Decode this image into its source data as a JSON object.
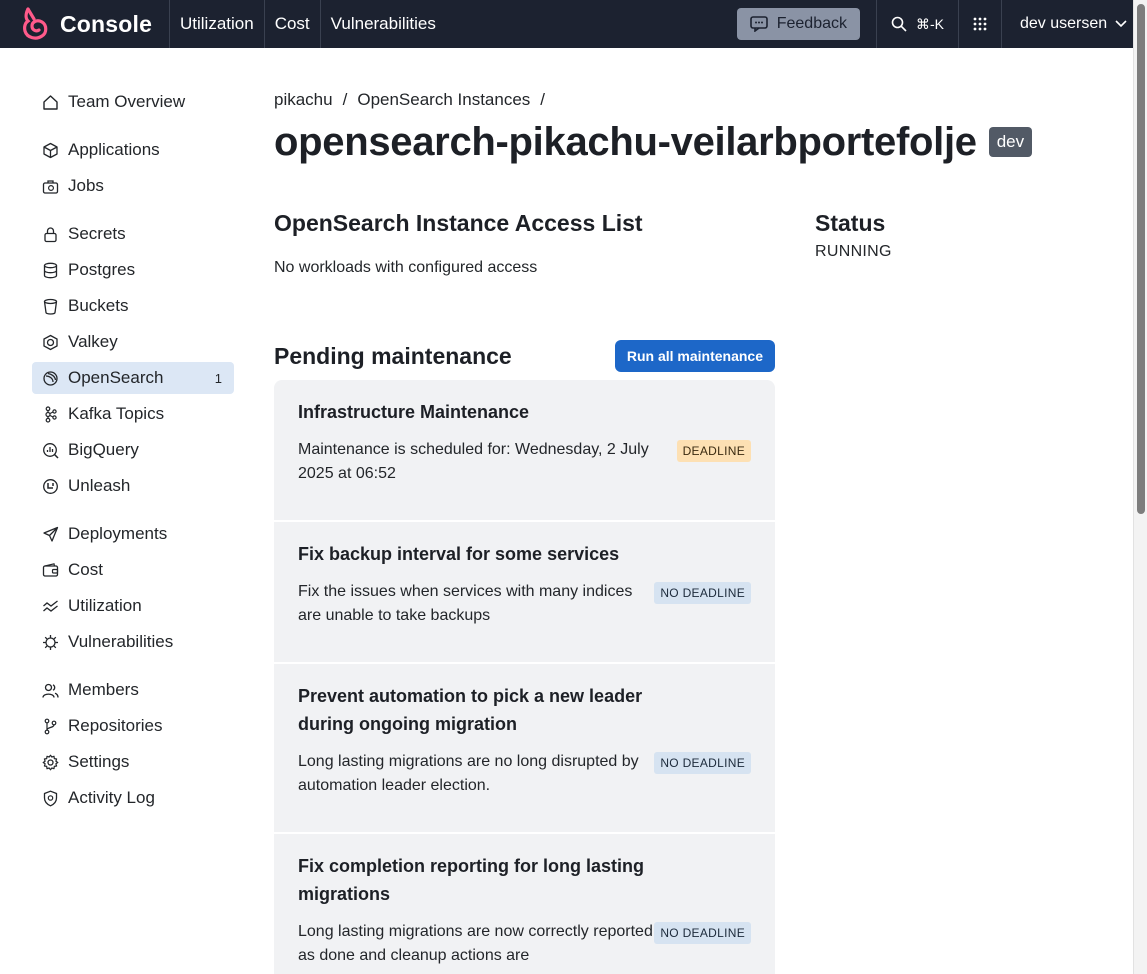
{
  "header": {
    "brand": "Console",
    "nav": [
      "Utilization",
      "Cost",
      "Vulnerabilities"
    ],
    "feedback": "Feedback",
    "search_shortcut": "⌘-K",
    "user": "dev usersen"
  },
  "sidebar": {
    "groups": [
      [
        {
          "label": "Team Overview",
          "icon": "home-icon"
        }
      ],
      [
        {
          "label": "Applications",
          "icon": "cube-icon"
        },
        {
          "label": "Jobs",
          "icon": "briefcase-icon"
        }
      ],
      [
        {
          "label": "Secrets",
          "icon": "lock-icon"
        },
        {
          "label": "Postgres",
          "icon": "database-icon"
        },
        {
          "label": "Buckets",
          "icon": "bucket-icon"
        },
        {
          "label": "Valkey",
          "icon": "valkey-icon"
        },
        {
          "label": "OpenSearch",
          "icon": "opensearch-icon",
          "count": "1",
          "active": true
        },
        {
          "label": "Kafka Topics",
          "icon": "kafka-icon"
        },
        {
          "label": "BigQuery",
          "icon": "bigquery-icon"
        },
        {
          "label": "Unleash",
          "icon": "unleash-icon"
        }
      ],
      [
        {
          "label": "Deployments",
          "icon": "rocket-icon"
        },
        {
          "label": "Cost",
          "icon": "wallet-icon"
        },
        {
          "label": "Utilization",
          "icon": "trend-icon"
        },
        {
          "label": "Vulnerabilities",
          "icon": "virus-icon"
        }
      ],
      [
        {
          "label": "Members",
          "icon": "people-icon"
        },
        {
          "label": "Repositories",
          "icon": "branch-icon"
        },
        {
          "label": "Settings",
          "icon": "gear-icon"
        },
        {
          "label": "Activity Log",
          "icon": "shield-icon"
        }
      ]
    ]
  },
  "breadcrumb": {
    "team": "pikachu",
    "section": "OpenSearch Instances",
    "sep": "/"
  },
  "page": {
    "title": "opensearch-pikachu-veilarbportefolje",
    "env": "dev"
  },
  "access": {
    "heading": "OpenSearch Instance Access List",
    "empty": "No workloads with configured access"
  },
  "status": {
    "heading": "Status",
    "value": "RUNNING"
  },
  "maintenance": {
    "heading": "Pending maintenance",
    "run_all": "Run all maintenance",
    "items": [
      {
        "title": "Infrastructure Maintenance",
        "desc": "Maintenance is scheduled for: Wednesday, 2 July 2025 at 06:52",
        "badge": "DEADLINE",
        "type": "deadline"
      },
      {
        "title": "Fix backup interval for some services",
        "desc": "Fix the issues when services with many indices are unable to take backups",
        "badge": "NO DEADLINE",
        "type": "none"
      },
      {
        "title": "Prevent automation to pick a new leader during ongoing migration",
        "desc": "Long lasting migrations are no long disrupted by automation leader election.",
        "badge": "NO DEADLINE",
        "type": "none"
      },
      {
        "title": "Fix completion reporting for long lasting migrations",
        "desc": "Long lasting migrations are now correctly reported as done and cleanup actions are",
        "badge": "NO DEADLINE",
        "type": "none"
      }
    ]
  },
  "colors": {
    "topbar": "#1c2230",
    "primary": "#1d67c8",
    "active_nav": "#dce7f5",
    "card_bg": "#f1f2f4",
    "deadline": "#fde0b3",
    "no_deadline": "#d6e3f1"
  }
}
